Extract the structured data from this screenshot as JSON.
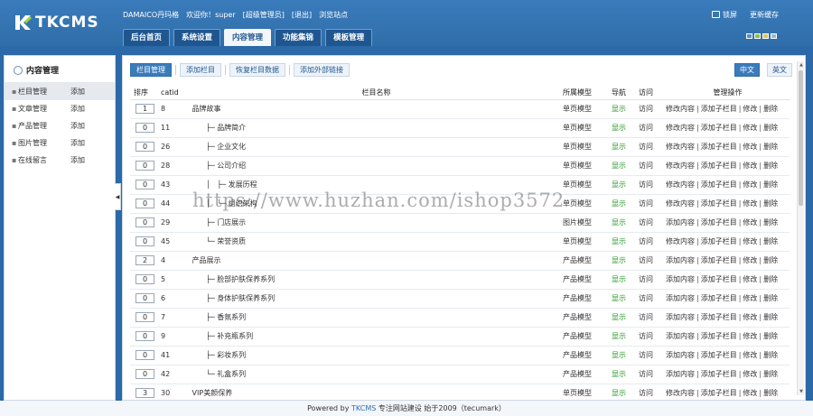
{
  "header": {
    "logo_text": "TKCMS",
    "top_info": [
      "DAMAICO丹玛格",
      "欢迎你！super",
      "[超级管理员]",
      "[退出]",
      "浏览站点"
    ],
    "lock_label": "锁屏",
    "cache_label": "更新缓存",
    "nav_tabs": [
      "后台首页",
      "系统设置",
      "内容管理",
      "功能集锦",
      "模板管理"
    ],
    "active_tab": "内容管理",
    "skin_colors": [
      "#5d8ec4",
      "#8ec23a",
      "#e3c44c",
      "#9bb6d3"
    ]
  },
  "sidebar": {
    "title": "内容管理",
    "items": [
      {
        "name": "栏目管理",
        "add": "添加",
        "active": true
      },
      {
        "name": "文章管理",
        "add": "添加"
      },
      {
        "name": "产品管理",
        "add": "添加"
      },
      {
        "name": "图片管理",
        "add": "添加"
      },
      {
        "name": "在线留言",
        "add": "添加"
      }
    ]
  },
  "toolbar": {
    "buttons": [
      "栏目管理",
      "添加栏目",
      "恢复栏目数据",
      "添加外部链接"
    ],
    "languages": [
      "中文",
      "英文"
    ]
  },
  "table": {
    "headers": [
      "排序",
      "catid",
      "栏目名称",
      "所属模型",
      "导航",
      "访问",
      "管理操作"
    ],
    "rows": [
      {
        "order": "1",
        "catid": "8",
        "name": "品牌故事",
        "prefix": "",
        "model": "单页模型",
        "nav": "显示",
        "visit": "访问",
        "ops": [
          "修改内容",
          "添加子栏目",
          "修改",
          "删除"
        ]
      },
      {
        "order": "0",
        "catid": "11",
        "name": "品牌简介",
        "prefix": "├─",
        "model": "单页模型",
        "nav": "显示",
        "visit": "访问",
        "ops": [
          "修改内容",
          "添加子栏目",
          "修改",
          "删除"
        ]
      },
      {
        "order": "0",
        "catid": "26",
        "name": "企业文化",
        "prefix": "├─",
        "model": "单页模型",
        "nav": "显示",
        "visit": "访问",
        "ops": [
          "修改内容",
          "添加子栏目",
          "修改",
          "删除"
        ]
      },
      {
        "order": "0",
        "catid": "28",
        "name": "公司介绍",
        "prefix": "├─",
        "model": "单页模型",
        "nav": "显示",
        "visit": "访问",
        "ops": [
          "修改内容",
          "添加子栏目",
          "修改",
          "删除"
        ]
      },
      {
        "order": "0",
        "catid": "43",
        "name": "发展历程",
        "prefix": "│   ├─",
        "model": "单页模型",
        "nav": "显示",
        "visit": "访问",
        "ops": [
          "修改内容",
          "添加子栏目",
          "修改",
          "删除"
        ]
      },
      {
        "order": "0",
        "catid": "44",
        "name": "组织架构",
        "prefix": "│   └─",
        "model": "单页模型",
        "nav": "显示",
        "visit": "访问",
        "ops": [
          "修改内容",
          "添加子栏目",
          "修改",
          "删除"
        ]
      },
      {
        "order": "0",
        "catid": "29",
        "name": "门店展示",
        "prefix": "├─",
        "model": "图片模型",
        "nav": "显示",
        "visit": "访问",
        "ops": [
          "添加内容",
          "添加子栏目",
          "修改",
          "删除"
        ]
      },
      {
        "order": "0",
        "catid": "45",
        "name": "荣誉资质",
        "prefix": "└─",
        "model": "单页模型",
        "nav": "显示",
        "visit": "访问",
        "ops": [
          "修改内容",
          "添加子栏目",
          "修改",
          "删除"
        ]
      },
      {
        "order": "2",
        "catid": "4",
        "name": "产品展示",
        "prefix": "",
        "model": "产品模型",
        "nav": "显示",
        "visit": "访问",
        "ops": [
          "添加内容",
          "添加子栏目",
          "修改",
          "删除"
        ]
      },
      {
        "order": "0",
        "catid": "5",
        "name": "脸部护肤保养系列",
        "prefix": "├─",
        "model": "产品模型",
        "nav": "显示",
        "visit": "访问",
        "ops": [
          "添加内容",
          "添加子栏目",
          "修改",
          "删除"
        ]
      },
      {
        "order": "0",
        "catid": "6",
        "name": "身体护肤保养系列",
        "prefix": "├─",
        "model": "产品模型",
        "nav": "显示",
        "visit": "访问",
        "ops": [
          "添加内容",
          "添加子栏目",
          "修改",
          "删除"
        ]
      },
      {
        "order": "0",
        "catid": "7",
        "name": "香氛系列",
        "prefix": "├─",
        "model": "产品模型",
        "nav": "显示",
        "visit": "访问",
        "ops": [
          "添加内容",
          "添加子栏目",
          "修改",
          "删除"
        ]
      },
      {
        "order": "0",
        "catid": "9",
        "name": "补充瓶系列",
        "prefix": "├─",
        "model": "产品模型",
        "nav": "显示",
        "visit": "访问",
        "ops": [
          "添加内容",
          "添加子栏目",
          "修改",
          "删除"
        ]
      },
      {
        "order": "0",
        "catid": "41",
        "name": "彩妆系列",
        "prefix": "├─",
        "model": "产品模型",
        "nav": "显示",
        "visit": "访问",
        "ops": [
          "添加内容",
          "添加子栏目",
          "修改",
          "删除"
        ]
      },
      {
        "order": "0",
        "catid": "42",
        "name": "礼盒系列",
        "prefix": "└─",
        "model": "产品模型",
        "nav": "显示",
        "visit": "访问",
        "ops": [
          "添加内容",
          "添加子栏目",
          "修改",
          "删除"
        ]
      },
      {
        "order": "3",
        "catid": "30",
        "name": "VIP美颜保养",
        "prefix": "",
        "model": "单页模型",
        "nav": "显示",
        "visit": "访问",
        "ops": [
          "修改内容",
          "添加子栏目",
          "修改",
          "删除"
        ]
      }
    ]
  },
  "footer": {
    "powered": "Powered by",
    "brand": "TKCMS",
    "tail": "专注网站建设  始于2009（tecumark）"
  },
  "watermark": "https://www.huzhan.com/ishop3572"
}
